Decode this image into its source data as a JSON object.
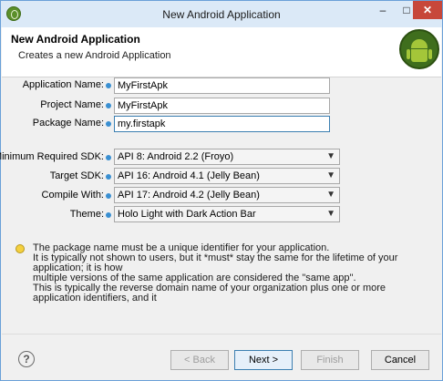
{
  "window": {
    "title": "New Android Application"
  },
  "header": {
    "title": "New Android Application",
    "subtitle": "Creates a new Android Application"
  },
  "form": {
    "application_name": {
      "label": "Application Name:",
      "value": "MyFirstApk"
    },
    "project_name": {
      "label": "Project Name:",
      "value": "MyFirstApk"
    },
    "package_name": {
      "label": "Package Name:",
      "value": "my.firstapk"
    }
  },
  "sdk": {
    "min_sdk": {
      "label": "Minimum Required SDK:",
      "value": "API 8: Android 2.2 (Froyo)"
    },
    "target_sdk": {
      "label": "Target SDK:",
      "value": "API 16: Android 4.1 (Jelly Bean)"
    },
    "compile_with": {
      "label": "Compile With:",
      "value": "API 17: Android 4.2 (Jelly Bean)"
    },
    "theme": {
      "label": "Theme:",
      "value": "Holo Light with Dark Action Bar"
    }
  },
  "message": {
    "line1": "The package name must be a unique identifier for your application.",
    "line2": "It is typically not shown to users, but it *must* stay the same for the lifetime of your application; it is how",
    "line3": "multiple versions of the same application are considered the \"same app\".",
    "line4": "This is typically the reverse domain name of your organization plus one or more application identifiers, and it"
  },
  "buttons": {
    "back": "< Back",
    "next": "Next >",
    "finish": "Finish",
    "cancel": "Cancel",
    "help": "?"
  },
  "icons": {
    "app": "eclipse-icon",
    "logo": "android-logo",
    "info": "info-icon",
    "bulb": "lightbulb-icon",
    "help": "help-icon"
  },
  "titlebar": {
    "minimize": "–",
    "maximize": "□",
    "close": "✕"
  },
  "colors": {
    "accent": "#3c7fb1",
    "close": "#c7473a",
    "android": "#a4c639"
  }
}
